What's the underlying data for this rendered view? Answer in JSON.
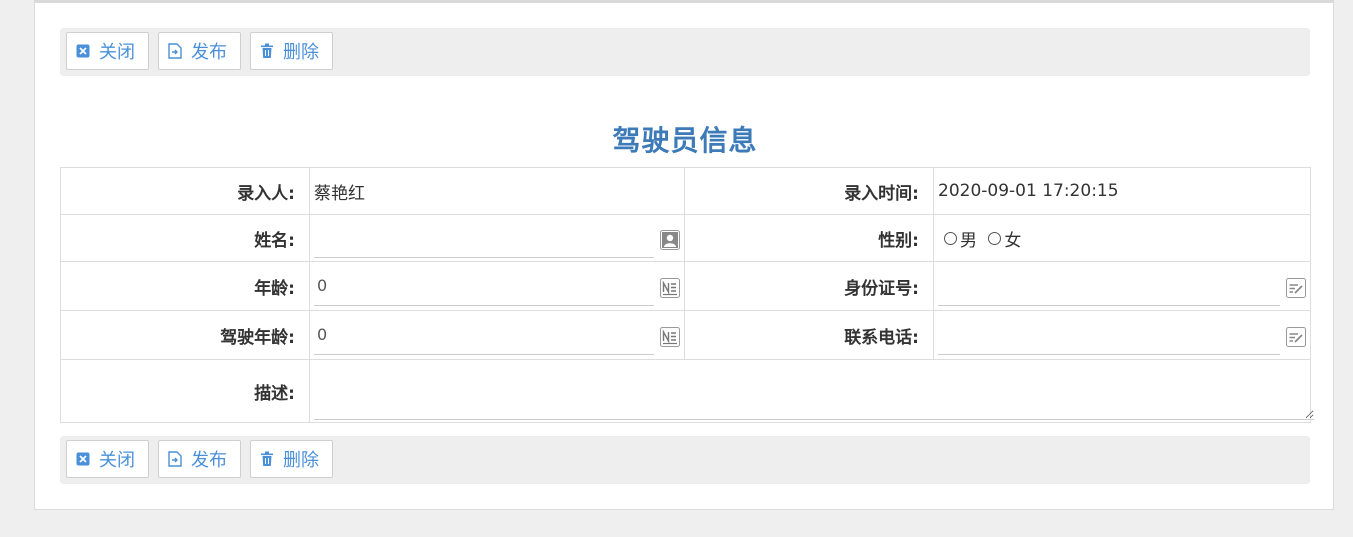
{
  "toolbar": {
    "close_label": "关闭",
    "publish_label": "发布",
    "delete_label": "删除"
  },
  "form": {
    "title": "驾驶员信息",
    "entered_by_label": "录入人:",
    "entered_by_value": "蔡艳红",
    "entry_time_label": "录入时间:",
    "entry_time_value": "2020-09-01 17:20:15",
    "name_label": "姓名:",
    "name_value": "",
    "gender_label": "性别:",
    "gender_options": [
      "男",
      "女"
    ],
    "age_label": "年龄:",
    "age_value": "0",
    "id_number_label": "身份证号:",
    "id_number_value": "",
    "driving_years_label": "驾驶年龄:",
    "driving_years_value": "0",
    "phone_label": "联系电话:",
    "phone_value": "",
    "description_label": "描述:",
    "description_value": ""
  },
  "colors": {
    "accent": "#4a90d9",
    "title": "#3d7ab8",
    "toolbar_bg": "#eeeeee"
  }
}
